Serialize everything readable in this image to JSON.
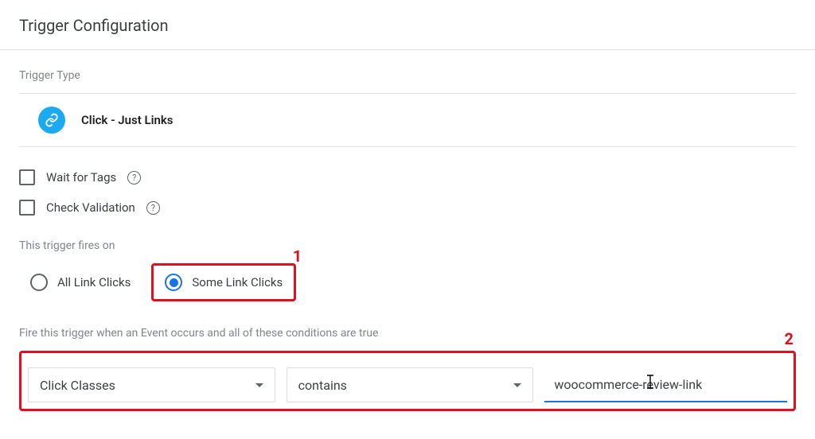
{
  "page": {
    "title": "Trigger Configuration"
  },
  "triggerType": {
    "label": "Trigger Type",
    "name": "Click - Just Links",
    "iconName": "link-icon"
  },
  "options": {
    "waitForTags": {
      "label": "Wait for Tags",
      "checked": false
    },
    "checkValidation": {
      "label": "Check Validation",
      "checked": false
    }
  },
  "firesOn": {
    "label": "This trigger fires on",
    "choices": [
      {
        "label": "All Link Clicks",
        "selected": false
      },
      {
        "label": "Some Link Clicks",
        "selected": true
      }
    ]
  },
  "condition": {
    "label": "Fire this trigger when an Event occurs and all of these conditions are true",
    "variable": "Click Classes",
    "operator": "contains",
    "value": "woocommerce-review-link"
  },
  "annotations": {
    "one": "1",
    "two": "2"
  }
}
